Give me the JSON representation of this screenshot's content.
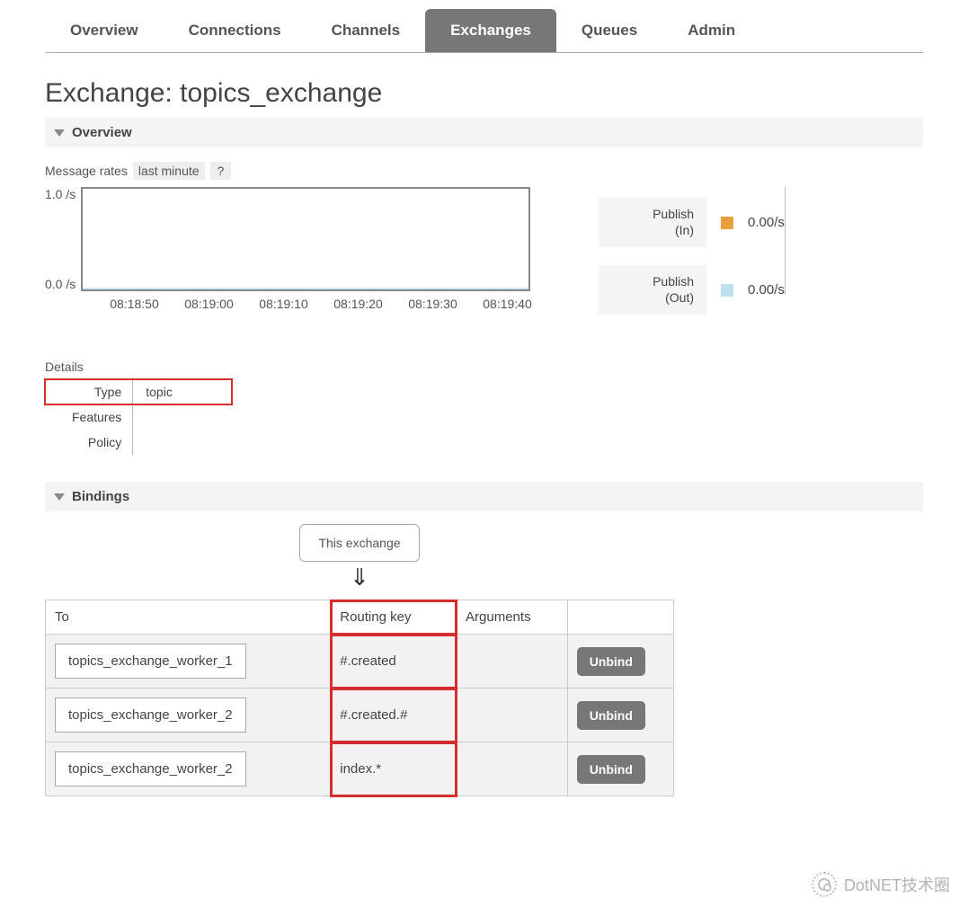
{
  "tabs": [
    {
      "label": "Overview"
    },
    {
      "label": "Connections"
    },
    {
      "label": "Channels"
    },
    {
      "label": "Exchanges",
      "active": true
    },
    {
      "label": "Queues"
    },
    {
      "label": "Admin"
    }
  ],
  "page_title_prefix": "Exchange: ",
  "page_title_name": "topics_exchange",
  "sections": {
    "overview_label": "Overview",
    "bindings_label": "Bindings"
  },
  "message_rates": {
    "label": "Message rates",
    "range": "last minute",
    "help": "?"
  },
  "legend": {
    "publish_in": {
      "label_line1": "Publish",
      "label_line2": "(In)",
      "value": "0.00/s",
      "color": "#e8a03c"
    },
    "publish_out": {
      "label_line1": "Publish",
      "label_line2": "(Out)",
      "value": "0.00/s",
      "color": "#bfe0ef"
    }
  },
  "details": {
    "title": "Details",
    "rows": [
      {
        "label": "Type",
        "value": "topic",
        "highlight": true
      },
      {
        "label": "Features",
        "value": ""
      },
      {
        "label": "Policy",
        "value": ""
      }
    ]
  },
  "bindings": {
    "this_exchange_label": "This exchange",
    "arrow": "⇓",
    "columns": {
      "to": "To",
      "routing_key": "Routing key",
      "arguments": "Arguments",
      "action": ""
    },
    "unbind_label": "Unbind",
    "rows": [
      {
        "to": "topics_exchange_worker_1",
        "routing_key": "#.created",
        "arguments": ""
      },
      {
        "to": "topics_exchange_worker_2",
        "routing_key": "#.created.#",
        "arguments": ""
      },
      {
        "to": "topics_exchange_worker_2",
        "routing_key": "index.*",
        "arguments": ""
      }
    ]
  },
  "watermark": "DotNET技术圈",
  "chart_data": {
    "type": "line",
    "title": "Message rates",
    "xlabel": "",
    "ylabel": "/s",
    "ylim": [
      0.0,
      1.0
    ],
    "y_ticks": [
      "1.0 /s",
      "0.0 /s"
    ],
    "x_ticks": [
      "08:18:50",
      "08:19:00",
      "08:19:10",
      "08:19:20",
      "08:19:30",
      "08:19:40"
    ],
    "series": [
      {
        "name": "Publish (In)",
        "color": "#e8a03c",
        "values": [
          0,
          0,
          0,
          0,
          0,
          0
        ]
      },
      {
        "name": "Publish (Out)",
        "color": "#bfe0ef",
        "values": [
          0,
          0,
          0,
          0,
          0,
          0
        ]
      }
    ]
  }
}
